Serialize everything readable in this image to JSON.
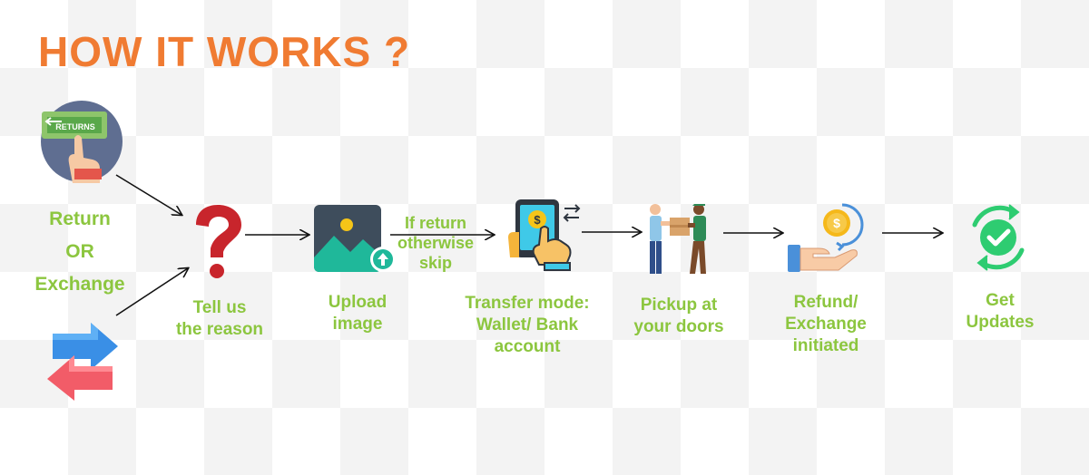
{
  "title": "HOW IT WORKS ?",
  "colors": {
    "title": "#f07b32",
    "label": "#8cc63f",
    "arrow": "#111111"
  },
  "start": {
    "returns_sign": "RETURNS",
    "lines": [
      "Return",
      "OR",
      "Exchange"
    ]
  },
  "steps": [
    {
      "icon": "question-mark-icon",
      "lines": [
        "Tell us",
        "the reason"
      ]
    },
    {
      "icon": "image-upload-icon",
      "lines": [
        "Upload",
        "image"
      ]
    },
    {
      "icon": "mobile-payment-icon",
      "lines": [
        "Transfer mode:",
        "Wallet/ Bank",
        "account"
      ]
    },
    {
      "icon": "delivery-handover-icon",
      "lines": [
        "Pickup at",
        "your doors"
      ]
    },
    {
      "icon": "refund-coin-hand-icon",
      "lines": [
        "Refund/",
        "Exchange",
        "initiated"
      ]
    },
    {
      "icon": "check-refresh-icon",
      "lines": [
        "Get",
        "Updates"
      ]
    }
  ],
  "connector_note": {
    "lines": [
      "If return",
      "otherwise",
      "skip"
    ]
  }
}
